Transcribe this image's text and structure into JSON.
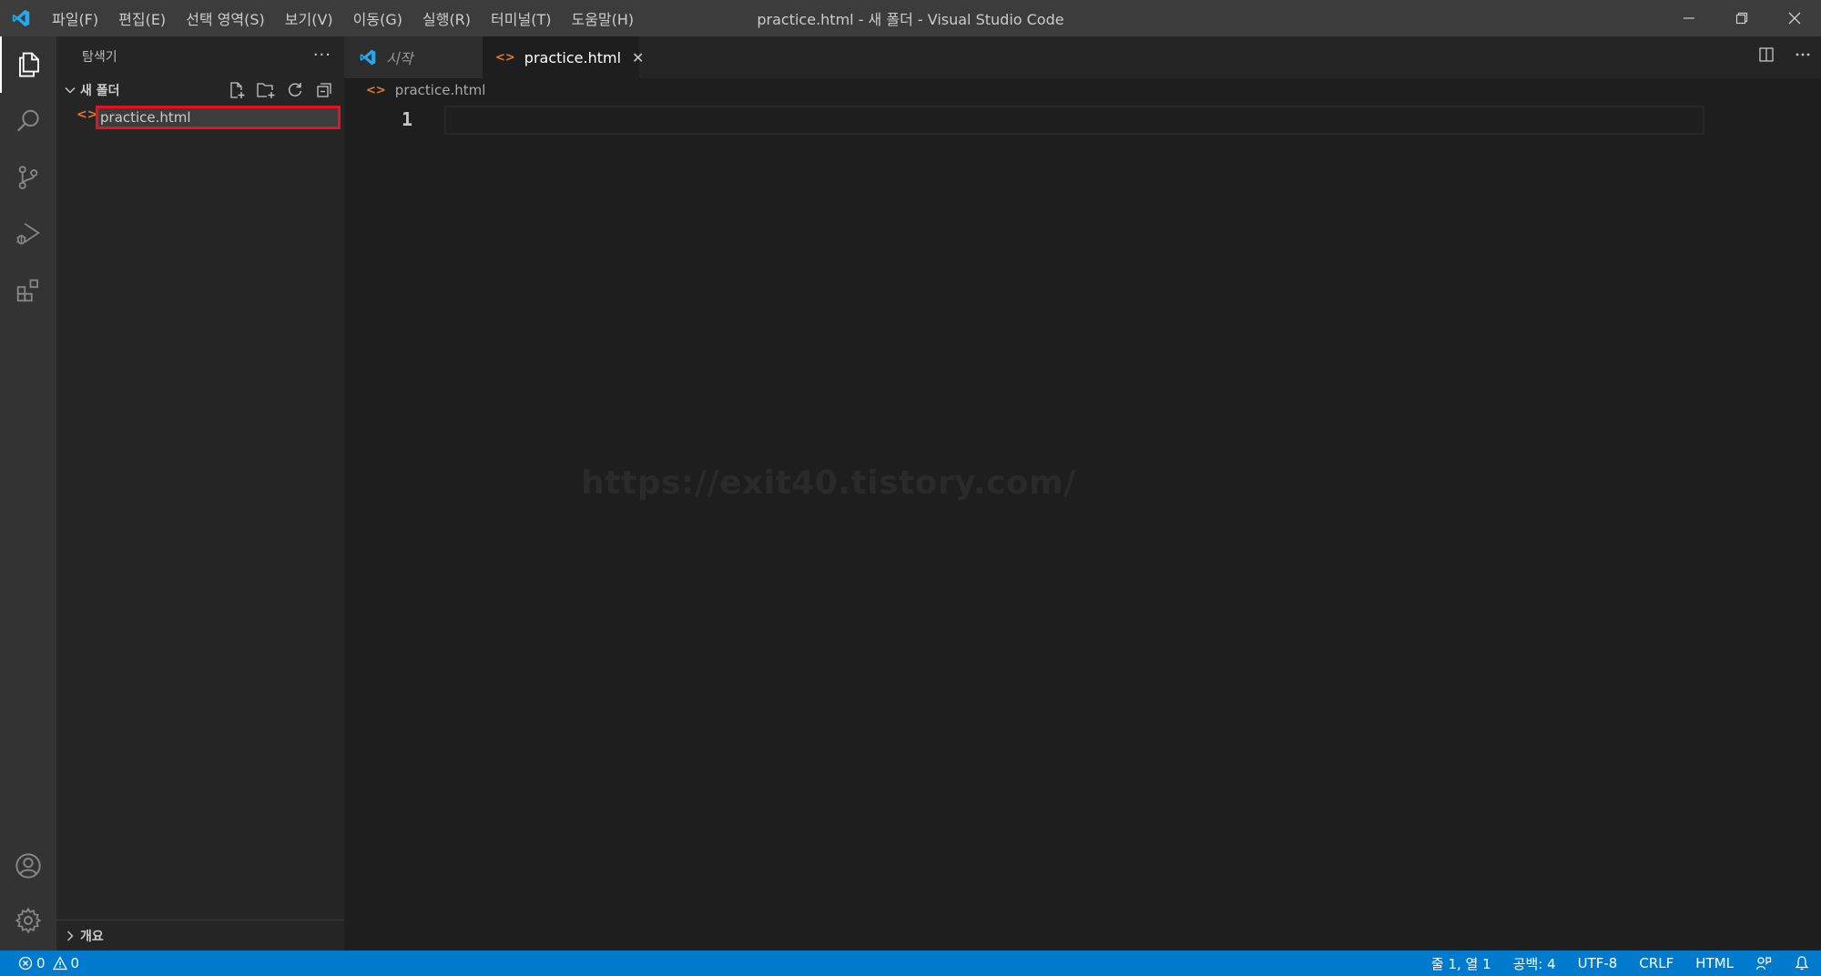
{
  "titlebar": {
    "menu": [
      "파일(F)",
      "편집(E)",
      "선택 영역(S)",
      "보기(V)",
      "이동(G)",
      "실행(R)",
      "터미널(T)",
      "도움말(H)"
    ],
    "title": "practice.html - 새 폴더 - Visual Studio Code"
  },
  "sidebar": {
    "header": "탐색기",
    "more": "···",
    "folder_name": "새 폴더",
    "file_icon": "<>",
    "rename_value": "practice.html",
    "outline": "개요"
  },
  "tabs": {
    "start_label": "시작",
    "active_label": "practice.html",
    "active_icon": "<>",
    "close": "✕"
  },
  "breadcrumb": {
    "icon": "<>",
    "file": "practice.html"
  },
  "editor": {
    "line_number": "1",
    "watermark": "https://exit40.tistory.com/"
  },
  "statusbar": {
    "errors": "0",
    "warnings": "0",
    "position": "줄 1, 열 1",
    "spaces": "공백: 4",
    "encoding": "UTF-8",
    "eol": "CRLF",
    "language": "HTML"
  },
  "colors": {
    "accent": "#007acc",
    "html_icon": "#e37933",
    "highlight_box": "#e81123",
    "vscode_logo": "#23a9f2"
  },
  "icons": {
    "activity": [
      "explorer-icon",
      "search-icon",
      "source-control-icon",
      "run-debug-icon",
      "extensions-icon",
      "accounts-icon",
      "manage-gear-icon"
    ],
    "folder_actions": [
      "new-file-icon",
      "new-folder-icon",
      "refresh-icon",
      "collapse-all-icon"
    ]
  }
}
